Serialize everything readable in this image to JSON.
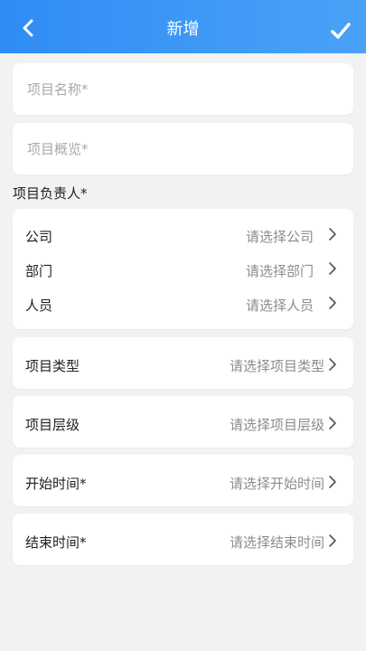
{
  "header": {
    "title": "新增"
  },
  "form": {
    "name_placeholder": "项目名称*",
    "overview_placeholder": "项目概览*",
    "owner_section_label": "项目负责人*",
    "owner_rows": [
      {
        "label": "公司",
        "placeholder": "请选择公司"
      },
      {
        "label": "部门",
        "placeholder": "请选择部门"
      },
      {
        "label": "人员",
        "placeholder": "请选择人员"
      }
    ],
    "type": {
      "label": "项目类型",
      "placeholder": "请选择项目类型"
    },
    "level": {
      "label": "项目层级",
      "placeholder": "请选择项目层级"
    },
    "start_time": {
      "label": "开始时间*",
      "placeholder": "请选择开始时间"
    },
    "end_time": {
      "label": "结束时间*",
      "placeholder": "请选择结束时间"
    }
  },
  "colors": {
    "header_start": "#2f8cf5",
    "header_end": "#4aa2f7",
    "background": "#f1f2f4"
  }
}
